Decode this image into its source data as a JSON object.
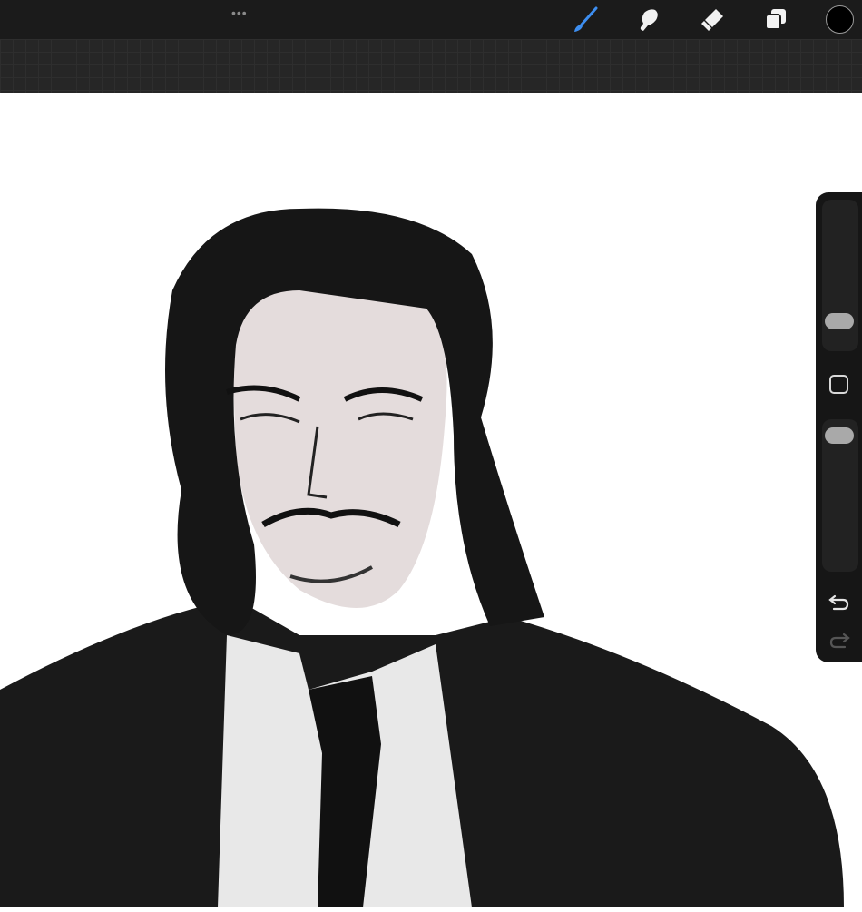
{
  "toolbar": {
    "icons": [
      "more-icon",
      "brush-icon",
      "smudge-icon",
      "eraser-icon",
      "layers-icon",
      "color-swatch"
    ],
    "active_tool": "brush",
    "more_label": "•••"
  },
  "colors": {
    "accent": "#3d8ef0",
    "current_color": "#000000",
    "toolbar_bg": "#1b1b1b"
  },
  "sidebar": {
    "brush_size": 0.16,
    "opacity": 0.94,
    "icons": [
      "modify-button",
      "undo-icon",
      "redo-icon"
    ]
  }
}
